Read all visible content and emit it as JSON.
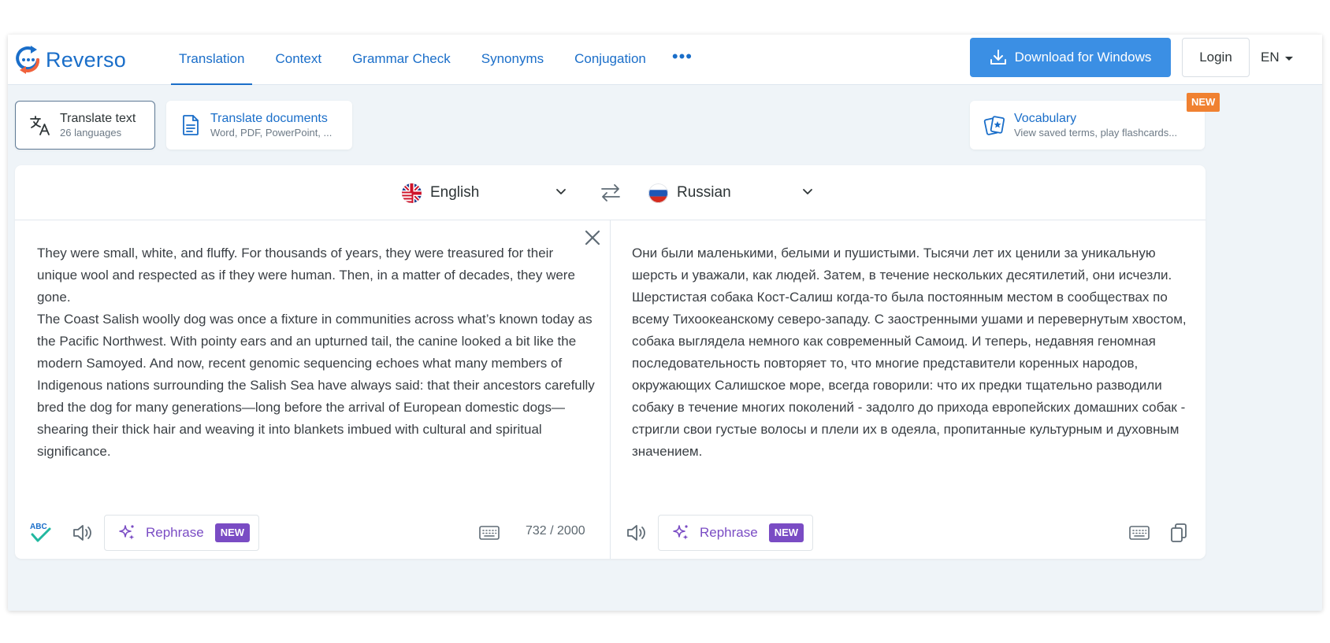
{
  "header": {
    "brand": "Reverso",
    "nav": [
      {
        "label": "Translation",
        "active": true
      },
      {
        "label": "Context",
        "active": false
      },
      {
        "label": "Grammar Check",
        "active": false
      },
      {
        "label": "Synonyms",
        "active": false
      },
      {
        "label": "Conjugation",
        "active": false
      }
    ],
    "more_label": "•••",
    "download_label": "Download for Windows",
    "login_label": "Login",
    "ui_language": "EN"
  },
  "modes": {
    "translate_text": {
      "title": "Translate text",
      "subtitle": "26 languages",
      "icon": "translate-icon"
    },
    "translate_docs": {
      "title": "Translate documents",
      "subtitle": "Word, PDF, PowerPoint, ...",
      "icon": "document-icon"
    },
    "vocabulary": {
      "title": "Vocabulary",
      "subtitle": "View saved terms, play flashcards...",
      "badge": "NEW",
      "icon": "flashcards-icon"
    }
  },
  "translator": {
    "source_language": "English",
    "target_language": "Russian",
    "source_text": "They were small, white, and fluffy. For thousands of years, they were treasured for their unique wool and respected as if they were human. Then, in a matter of decades, they were gone.\nThe Coast Salish woolly dog was once a fixture in communities across what’s known today as the Pacific Northwest. With pointy ears and an upturned tail, the canine looked a bit like the modern Samoyed. And now, recent genomic sequencing echoes what many members of Indigenous nations surrounding the Salish Sea have always said: that their ancestors carefully bred the dog for many generations—long before the arrival of European domestic dogs—shearing their thick hair and weaving it into blankets imbued with cultural and spiritual significance.",
    "target_text": "Они были маленькими, белыми и пушистыми. Тысячи лет их ценили за уникальную шерсть и уважали, как людей. Затем, в течение нескольких десятилетий, они исчезли.\nШерстистая собака Кост-Салиш когда-то была постоянным местом в сообществах по всему Тихоокеанскому северо-западу. С заостренными ушами и перевернутым хвостом, собака выглядела немного как современный Самоид. И теперь, недавняя геномная последовательность повторяет то, что многие представители коренных народов, окружающих Салишское море, всегда говорили: что их предки тщательно разводили собаку в течение многих поколений - задолго до прихода европейских домашних собак - стригли свои густые волосы и плели их в одеяла, пропитанные культурным и духовным значением.",
    "rephrase_label": "Rephrase",
    "rephrase_badge": "NEW",
    "spellcheck_label": "ABC",
    "char_count": "732 / 2000"
  },
  "colors": {
    "brand_blue": "#1a6ec9",
    "download_blue": "#3b8fe4",
    "rephrase_purple": "#7a4cc4",
    "new_orange": "#f08131"
  }
}
